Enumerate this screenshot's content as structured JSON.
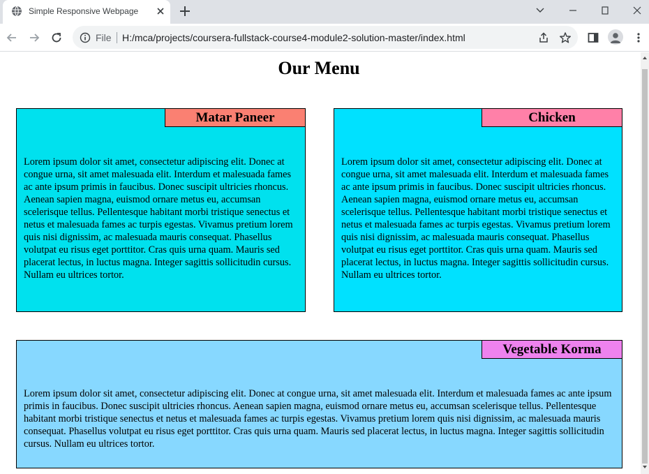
{
  "browser": {
    "tab_title": "Simple Responsive Webpage",
    "file_label": "File",
    "url": "H:/mca/projects/coursera-fullstack-course4-module2-solution-master/index.html",
    "icons": [
      "globe-icon",
      "close-icon",
      "plus-icon",
      "chevron-down-icon",
      "minimize-icon",
      "maximize-icon",
      "close-window-icon",
      "back-icon",
      "forward-icon",
      "reload-icon",
      "info-icon",
      "share-icon",
      "star-icon",
      "side-panel-icon",
      "profile-icon",
      "more-icon"
    ]
  },
  "page": {
    "heading": "Our Menu",
    "cards": [
      {
        "label": "Matar Paneer",
        "text": "Lorem ipsum dolor sit amet, consectetur adipiscing elit. Donec at congue urna, sit amet malesuada elit. Interdum et malesuada fames ac ante ipsum primis in faucibus. Donec suscipit ultricies rhoncus. Aenean sapien magna, euismod ornare metus eu, accumsan scelerisque tellus. Pellentesque habitant morbi tristique senectus et netus et malesuada fames ac turpis egestas. Vivamus pretium lorem quis nisi dignissim, ac malesuada mauris consequat. Phasellus volutpat eu risus eget porttitor. Cras quis urna quam. Mauris sed placerat lectus, in luctus magna. Integer sagittis sollicitudin cursus. Nullam eu ultrices tortor.",
        "bg": "#00e1ee",
        "label_bg": "#fa8072"
      },
      {
        "label": "Chicken",
        "text": "Lorem ipsum dolor sit amet, consectetur adipiscing elit. Donec at congue urna, sit amet malesuada elit. Interdum et malesuada fames ac ante ipsum primis in faucibus. Donec suscipit ultricies rhoncus. Aenean sapien magna, euismod ornare metus eu, accumsan scelerisque tellus. Pellentesque habitant morbi tristique senectus et netus et malesuada fames ac turpis egestas. Vivamus pretium lorem quis nisi dignissim, ac malesuada mauris consequat. Phasellus volutpat eu risus eget porttitor. Cras quis urna quam. Mauris sed placerat lectus, in luctus magna. Integer sagittis sollicitudin cursus. Nullam eu ultrices tortor.",
        "bg": "#00e1ff",
        "label_bg": "#ff80a8"
      },
      {
        "label": "Vegetable Korma",
        "text": "Lorem ipsum dolor sit amet, consectetur adipiscing elit. Donec at congue urna, sit amet malesuada elit. Interdum et malesuada fames ac ante ipsum primis in faucibus. Donec suscipit ultricies rhoncus. Aenean sapien magna, euismod ornare metus eu, accumsan scelerisque tellus. Pellentesque habitant morbi tristique senectus et netus et malesuada fames ac turpis egestas. Vivamus pretium lorem quis nisi dignissim, ac malesuada mauris consequat. Phasellus volutpat eu risus eget porttitor. Cras quis urna quam. Mauris sed placerat lectus, in luctus magna. Integer sagittis sollicitudin cursus. Nullam eu ultrices tortor.",
        "bg": "#87d8ff",
        "label_bg": "#ee82ee"
      }
    ]
  }
}
